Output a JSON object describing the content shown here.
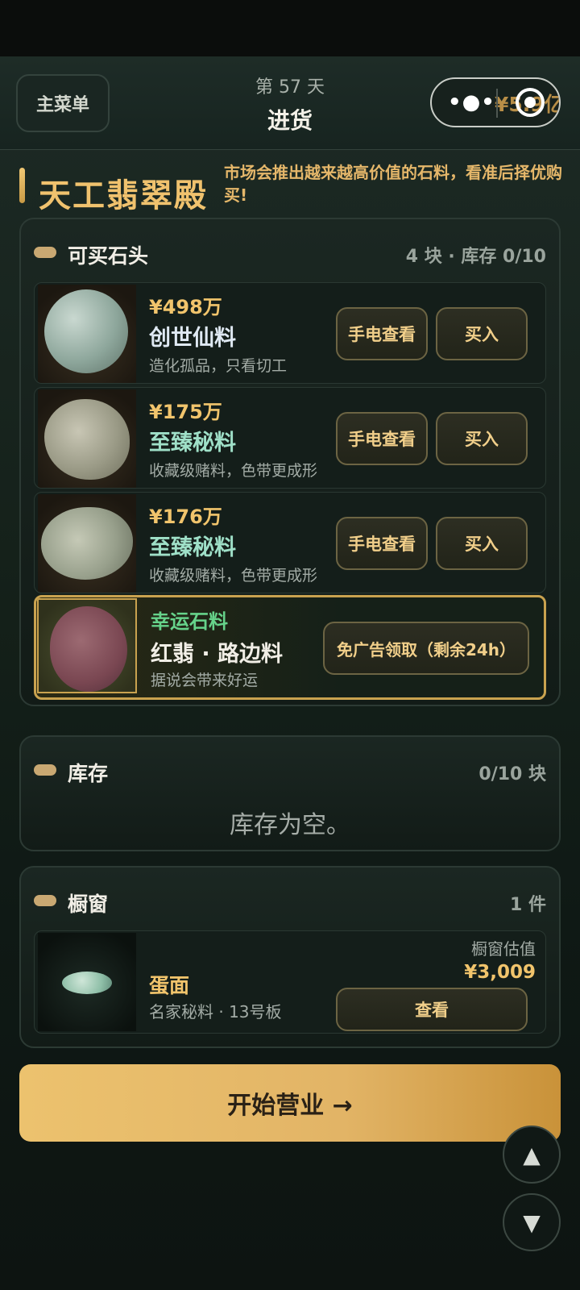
{
  "header": {
    "menu_label": "主菜单",
    "day_label": "第 57 天",
    "title": "进货",
    "money": "¥5.9亿",
    "more_icon": "more-dots-icon",
    "close_icon": "target-icon"
  },
  "shop": {
    "name": "天工翡翠殿",
    "tip": "市场会推出越来越高价值的石料，看准后择优购买!"
  },
  "buy_panel": {
    "title": "可买石头",
    "summary": "4 块 · 库存 0/10",
    "items": [
      {
        "price": "¥498万",
        "name": "创世仙料",
        "desc": "造化孤品，只看切工",
        "btn_light": "手电查看",
        "btn_buy": "买入"
      },
      {
        "price": "¥175万",
        "name": "至臻秘料",
        "desc": "收藏级赌料，色带更成形",
        "btn_light": "手电查看",
        "btn_buy": "买入"
      },
      {
        "price": "¥176万",
        "name": "至臻秘料",
        "desc": "收藏级赌料，色带更成形",
        "btn_light": "手电查看",
        "btn_buy": "买入"
      }
    ],
    "lucky": {
      "tag": "幸运石料",
      "name": "红翡 · 路边料",
      "desc": "据说会带来好运",
      "btn": "免广告领取（剩余24h）"
    }
  },
  "inventory": {
    "title": "库存",
    "count": "0/10 块",
    "empty": "库存为空。"
  },
  "window": {
    "title": "橱窗",
    "count": "1 件",
    "item": {
      "name": "蛋面",
      "desc": "名家秘料 · 13号板",
      "value_label": "橱窗估值",
      "value": "¥3,009",
      "btn": "查看"
    }
  },
  "start_button": "开始营业 →",
  "scroll": {
    "up": "▲",
    "down": "▼"
  },
  "colors": {
    "accent": "#f1c46c",
    "background": "#0d1512",
    "lucky_green": "#66d28a"
  }
}
